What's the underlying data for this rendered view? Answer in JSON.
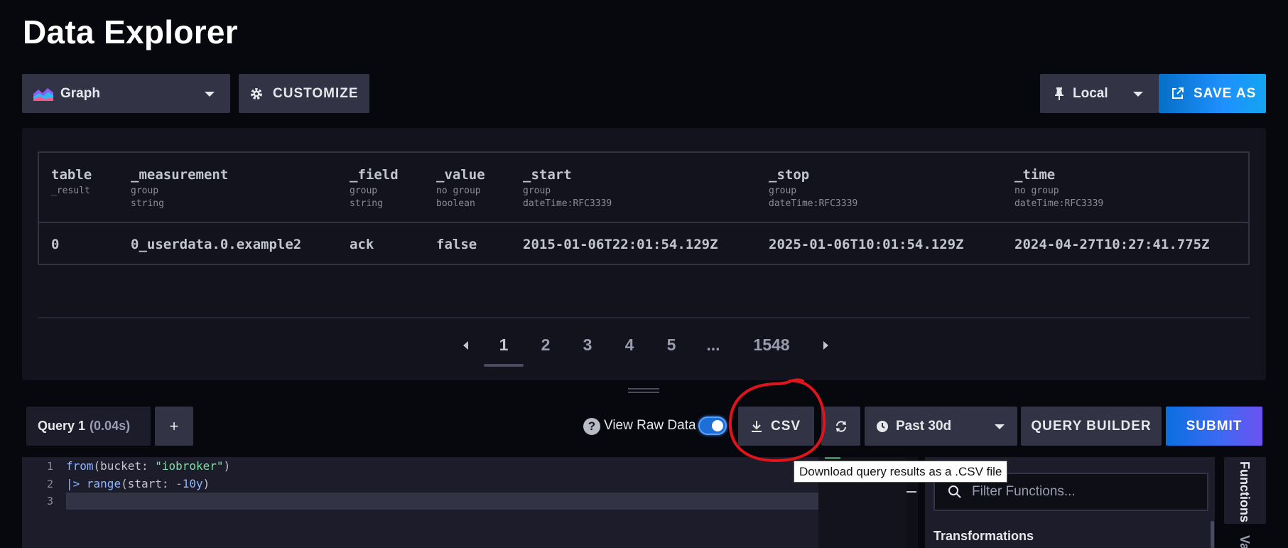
{
  "page": {
    "title": "Data Explorer"
  },
  "toolbar": {
    "graph_label": "Graph",
    "customize_label": "CUSTOMIZE",
    "local_label": "Local",
    "save_as_label": "SAVE AS",
    "graph_icon": "graph-icon",
    "gear_icon": "gear-icon",
    "pin_icon": "pin-icon",
    "external_icon": "external-link-icon"
  },
  "table": {
    "columns": [
      {
        "name": "table",
        "sub1": "_result",
        "sub2": ""
      },
      {
        "name": "_measurement",
        "sub1": "group",
        "sub2": "string"
      },
      {
        "name": "_field",
        "sub1": "group",
        "sub2": "string"
      },
      {
        "name": "_value",
        "sub1": "no group",
        "sub2": "boolean"
      },
      {
        "name": "_start",
        "sub1": "group",
        "sub2": "dateTime:RFC3339"
      },
      {
        "name": "_stop",
        "sub1": "group",
        "sub2": "dateTime:RFC3339"
      },
      {
        "name": "_time",
        "sub1": "no group",
        "sub2": "dateTime:RFC3339"
      }
    ],
    "rows": [
      [
        "0",
        "0_userdata.0.example2",
        "ack",
        "false",
        "2015-01-06T22:01:54.129Z",
        "2025-01-06T10:01:54.129Z",
        "2024-04-27T10:27:41.775Z"
      ]
    ]
  },
  "pagination": {
    "pages": [
      "1",
      "2",
      "3",
      "4",
      "5",
      "...",
      "1548"
    ],
    "current": "1"
  },
  "query": {
    "tab_name": "Query 1",
    "tab_time": "(0.04s)",
    "add_label": "+",
    "view_raw_label": "View Raw Data",
    "view_raw_enabled": true,
    "csv_label": "CSV",
    "time_range_label": "Past 30d",
    "query_builder_label": "QUERY BUILDER",
    "submit_label": "SUBMIT",
    "help_glyph": "?"
  },
  "editor": {
    "line_numbers": [
      "1",
      "2",
      "3"
    ],
    "line1": {
      "fn": "from",
      "open": "(bucket: ",
      "str": "\"iobroker\"",
      "close": ")"
    },
    "line2": {
      "pipe": "|>",
      "fn": "range",
      "open": "(start: ",
      "num": "-10y",
      "close": ")"
    }
  },
  "functions_panel": {
    "search_placeholder": "Filter Functions...",
    "heading": "Transformations",
    "tab_functions": "Functions",
    "tab_variables": "Va"
  },
  "tooltip": {
    "text": "Download query results as a .CSV file"
  },
  "colors": {
    "background": "#07070e",
    "panel": "#13131d",
    "button": "#333346",
    "primary_blue": "#1e90ff",
    "annotation_red": "#e0141c"
  }
}
